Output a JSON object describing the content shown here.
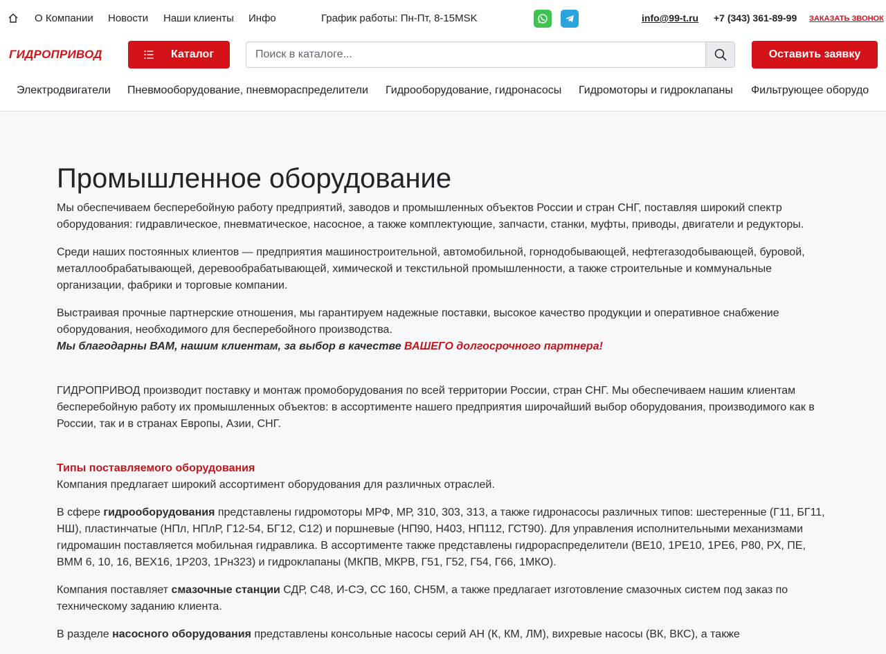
{
  "topbar": {
    "nav": [
      "О Компании",
      "Новости",
      "Наши клиенты",
      "Инфо"
    ],
    "schedule": "График работы: Пн-Пт, 8-15MSK",
    "email": "info@99-t.ru",
    "phone": "+7 (343) 361-89-99",
    "callback": "ЗАКАЗАТЬ ЗВОНОК"
  },
  "header": {
    "logo": "ГИДРОПРИВОД",
    "catalog_label": "Каталог",
    "search_placeholder": "Поиск в каталоге...",
    "request_label": "Оставить заявку"
  },
  "categories": [
    "Электродвигатели",
    "Пневмооборудование, пневмораспределители",
    "Гидрооборудование, гидронасосы",
    "Гидромоторы и гидроклапаны",
    "Фильтрующее оборудо"
  ],
  "content": {
    "title": "Промышленное оборудование",
    "p1": "Мы обеспечиваем бесперебойную работу предприятий, заводов и промышленных объектов России и стран СНГ, поставляя широкий спектр оборудования: гидравлическое, пневматическое, насосное, а также комплектующие, запчасти, станки, муфты, приводы, двигатели и редукторы.",
    "p2": "Среди наших постоянных клиентов — предприятия машиностроительной, автомобильной, горнодобывающей, нефтегазодобывающей, буровой, металлообрабатывающей, деревообрабатывающей, химической и текстильной промышленности, а также строительные и коммунальные организации, фабрики и торговые компании.",
    "p3": "Выстраивая прочные партнерские отношения, мы гарантируем надежные поставки, высокое качество продукции и оперативное снабжение оборудования, необходимого для бесперебойного производства.",
    "thanks_a": "Мы благодарны ВАМ, нашим клиентам, за выбор в качестве ",
    "thanks_b": "ВАШЕГО долгосрочного партнера!",
    "p4": "ГИДРОПРИВОД  производит поставку и монтаж промоборудования по всей территории России, стран СНГ. Мы обеспечиваем нашим клиентам бесперебойную работу их промышленных объектов: в ассортименте нашего предприятия широчайший выбор оборудования, производимого как в России, так и в странах Европы, Азии, СНГ.",
    "types_title": "Типы поставляемого оборудования",
    "types_intro": "Компания предлагает широкий ассортимент оборудования для различных отраслей.",
    "hydro_pre": "В сфере ",
    "hydro_bold": "гидрооборудования",
    "hydro_post": " представлены гидромоторы МРФ, МР, 310, 303, 313, а также гидронасосы различных типов: шестеренные (Г11, БГ11, НШ), пластинчатые (НПл, НПлР, Г12-54, БГ12, С12) и поршневые (НП90, Н403, НП112, ГСТ90). Для управления исполнительными механизмами гидромашин поставляется мобильная гидравлика. В ассортименте также представлены гидрораспределители (ВЕ10, 1РЕ10, 1РЕ6, Р80, РХ, ПЕ, ВММ 6, 10, 16, ВЕХ16, 1Р203, 1Рн323) и гидроклапаны (МКПВ, МКРВ, Г51, Г52, Г54, Г66, 1МКО).",
    "lube_pre": "Компания поставляет ",
    "lube_bold": "смазочные станции",
    "lube_post": " СДР, С48, И-СЭ, СС 160, СН5М, а также предлагает изготовление смазочных систем под заказ по техническому заданию клиента.",
    "pump_pre": "В разделе ",
    "pump_bold": "насосного оборудования",
    "pump_post": " представлены консольные насосы серий АН (К, КМ, ЛМ), вихревые насосы (ВК, ВКС), а также"
  },
  "colors": {
    "brand_red": "#d41217",
    "whatsapp": "#3fc350",
    "telegram": "#2aa3de"
  },
  "icons": [
    "home-icon",
    "whatsapp-icon",
    "telegram-icon",
    "list-icon",
    "search-icon"
  ]
}
